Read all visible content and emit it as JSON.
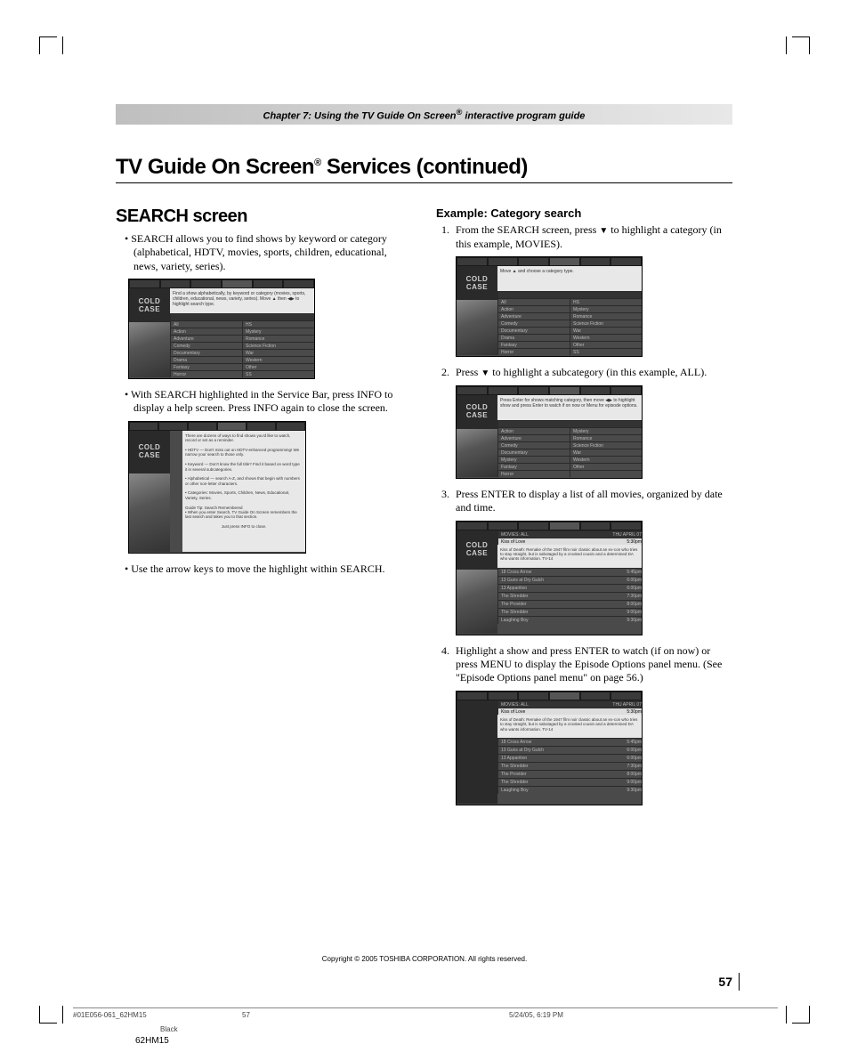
{
  "header": {
    "chapter": "Chapter 7: Using the TV Guide On Screen",
    "reg": "®",
    "chapter_tail": " interactive program guide"
  },
  "title": {
    "pre": "TV Guide On Screen",
    "reg": "®",
    "post": " Services (continued)"
  },
  "left": {
    "heading": "SEARCH screen",
    "b1": "SEARCH allows you to find shows by keyword or category (alphabetical, HDTV, movies, sports, children, educational, news, variety, series).",
    "b2": "With SEARCH highlighted in the Service Bar, press INFO to display a help screen. Press INFO again to close the screen.",
    "b3": "Use the arrow keys to move the highlight within SEARCH."
  },
  "right": {
    "subhead": "Example: Category search",
    "s1a": "From the SEARCH screen, press ",
    "s1b": " to highlight a category (in this example, MOVIES).",
    "s2a": "Press ",
    "s2b": " to highlight a subcategory (in this example, ALL).",
    "s3": "Press ENTER to display a list of all movies, organized by date and time.",
    "s4": "Highlight a show and press ENTER to watch (if on now) or press MENU to display the Episode Options panel menu. (See \"Episode Options panel menu\" on page 56.)"
  },
  "shots": {
    "cold": "COLD",
    "case": "CASE",
    "info1": "Find a show alphabetically, by keyword or category (movies, sports, children, educational, news, variety, series). Move ▲ then ◀▶ to highlight search type.",
    "info_help1": "There are dozens of ways to find shows you'd like to watch, record or set as a reminder.",
    "info_help2": "• HDTV — Don't miss out on HDTV-enhanced programming! We narrow your search to those only.",
    "info_help3": "• Keyword — Don't know the full title? Find it based on word type it­ in several subcategories.",
    "info_help4": "• Alphabetical — search A-Z, and shows that begin with numbers or other non-letter characters.",
    "info_help5": "• Categories: Movies, Sports, Children, News, Educational, Variety, Series.",
    "info_help6": "Guide Tip: Search Remembered",
    "info_help7": "• When you enter Search, TV Guide On Screen remembers the last search and takes you to that section.",
    "info_help8": "Just press INFO to close.",
    "info_move": "Move ▲ and choose a category type.",
    "info_sub": "Press Enter for shows matching category, then move ◀▶ to highlight show and press Enter to watch if on now or Menu for episode options.",
    "cat_l": [
      "All",
      "Action",
      "Adventure",
      "Comedy",
      "Documentary",
      "Drama",
      "Fantasy",
      "Horror"
    ],
    "cat_r": [
      "HS",
      "Mystery",
      "Romance",
      "Science Fiction",
      "War",
      "Western",
      "Other",
      "SS"
    ],
    "sub_l": [
      "Action",
      "Adventure",
      "Comedy",
      "Documentary",
      "Mystery",
      "Fantasy",
      "Horror"
    ],
    "sub_r": [
      "Mystery",
      "Romance",
      "Science Fiction",
      "War",
      "Western",
      "Other",
      ""
    ],
    "list_hdr_l": "MOVIES: ALL",
    "list_hdr_r": "THU  APRIL 07",
    "list_title": "Kiss of Love",
    "list_time": "5:30pm",
    "list_desc": "Kiss of Death: Remake of the 1947 film noir classic about an ex-con who tries to stay straight, but is sabotaged by a crooked cousin and a determined DA who wants information. TV-14",
    "list_rows_l": [
      "18 Cross Arrow",
      "13 Guns at Dry Gulch",
      "13 Apparition",
      "The Shredder",
      "The Provider",
      "The Shredder",
      "Laughing Boy"
    ],
    "list_rows_r": [
      "5:45pm",
      "6:00pm",
      "6:00pm",
      "7:30pm",
      "8:00pm",
      "9:00pm",
      "9:30pm"
    ]
  },
  "footer": {
    "copyright": "Copyright © 2005 TOSHIBA CORPORATION. All rights reserved.",
    "page": "57",
    "file": "#01E056-061_62HM15",
    "fpage": "57",
    "date": "5/24/05, 6:19 PM",
    "black": "Black",
    "model": "62HM15"
  }
}
